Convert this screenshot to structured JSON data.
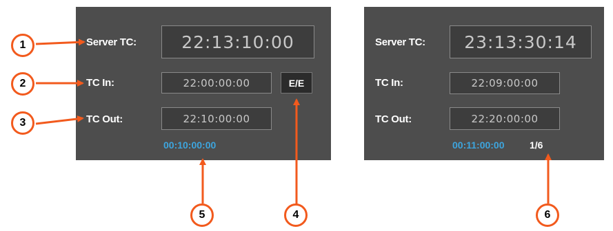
{
  "left": {
    "server_tc_label": "Server TC:",
    "server_tc_value": "22:13:10:00",
    "tc_in_label": "TC In:",
    "tc_in_value": "22:00:00:00",
    "tc_out_label": "TC Out:",
    "tc_out_value": "22:10:00:00",
    "ee_label": "E/E",
    "duration": "00:10:00:00"
  },
  "right": {
    "server_tc_label": "Server TC:",
    "server_tc_value": "23:13:30:14",
    "tc_in_label": "TC In:",
    "tc_in_value": "22:09:00:00",
    "tc_out_label": "TC Out:",
    "tc_out_value": "22:20:00:00",
    "duration": "00:11:00:00",
    "counter": "1/6"
  },
  "callouts": [
    "1",
    "2",
    "3",
    "4",
    "5",
    "6"
  ],
  "colors": {
    "panel": "#4d4d4d",
    "callout": "#f25a1d",
    "duration": "#3da5de"
  }
}
